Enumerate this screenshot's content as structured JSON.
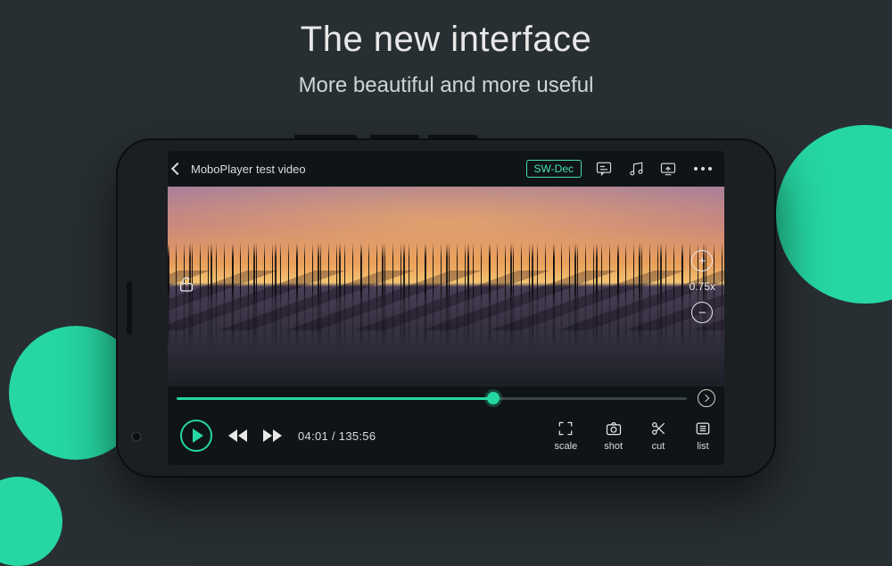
{
  "promo": {
    "headline": "The new interface",
    "subhead": "More beautiful and more useful"
  },
  "topbar": {
    "title": "MoboPlayer test video",
    "decoder_label": "SW-Dec"
  },
  "side": {
    "zoom_value": "0.75x"
  },
  "playback": {
    "current": "04:01",
    "total": "135:56",
    "progress_pct": 62
  },
  "tools": {
    "scale": "scale",
    "shot": "shot",
    "cut": "cut",
    "list": "list"
  },
  "colors": {
    "accent": "#26d7a3"
  }
}
